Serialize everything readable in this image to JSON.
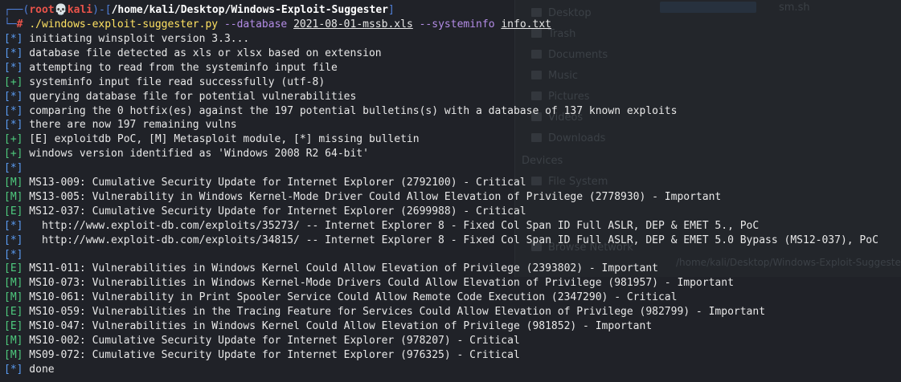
{
  "background_window": {
    "top_label": "sm.sh",
    "places": [
      {
        "label": "Desktop",
        "icon": "desktop-icon"
      },
      {
        "label": "Trash",
        "icon": "trash-icon"
      },
      {
        "label": "Documents",
        "icon": "folder-icon"
      },
      {
        "label": "Music",
        "icon": "folder-icon"
      },
      {
        "label": "Pictures",
        "icon": "folder-icon"
      },
      {
        "label": "Videos",
        "icon": "folder-icon"
      },
      {
        "label": "Downloads",
        "icon": "folder-icon"
      }
    ],
    "devices_heading": "Devices",
    "devices": [
      {
        "label": "File System",
        "icon": "drive-icon"
      }
    ],
    "network_label": "Browse Network",
    "path_text": "/home/kali/Desktop/Windows-Exploit-Suggester/"
  },
  "prompt": {
    "frame_start": "┌──(",
    "user": "root",
    "skull": "💀",
    "host": "kali",
    "frame_mid": ")-[",
    "cwd": "/home/kali/Desktop/Windows-Exploit-Suggester",
    "frame_end": "]",
    "frame_second": "└─",
    "hash": "#",
    "command": "./windows-exploit-suggester.py",
    "flag1": "--database",
    "arg1": "2021-08-01-mssb.xls",
    "flag2": "--systeminfo",
    "arg2": "info.txt"
  },
  "output_lines": [
    {
      "tag": "[*]",
      "kind": "info",
      "text": " initiating winsploit version 3.3..."
    },
    {
      "tag": "[*]",
      "kind": "info",
      "text": " database file detected as xls or xlsx based on extension"
    },
    {
      "tag": "[*]",
      "kind": "info",
      "text": " attempting to read from the systeminfo input file"
    },
    {
      "tag": "[+]",
      "kind": "ok",
      "text": " systeminfo input file read successfully (utf-8)"
    },
    {
      "tag": "[*]",
      "kind": "info",
      "text": " querying database file for potential vulnerabilities"
    },
    {
      "tag": "[*]",
      "kind": "info",
      "text": " comparing the 0 hotfix(es) against the 197 potential bulletins(s) with a database of 137 known exploits"
    },
    {
      "tag": "[*]",
      "kind": "info",
      "text": " there are now 197 remaining vulns"
    },
    {
      "tag": "[+]",
      "kind": "ok",
      "text": " [E] exploitdb PoC, [M] Metasploit module, [*] missing bulletin"
    },
    {
      "tag": "[+]",
      "kind": "ok",
      "text": " windows version identified as 'Windows 2008 R2 64-bit'"
    },
    {
      "tag": "[*]",
      "kind": "info",
      "text": ""
    },
    {
      "tag": "[M]",
      "kind": "m",
      "text": " MS13-009: Cumulative Security Update for Internet Explorer (2792100) - Critical"
    },
    {
      "tag": "[M]",
      "kind": "m",
      "text": " MS13-005: Vulnerability in Windows Kernel-Mode Driver Could Allow Elevation of Privilege (2778930) - Important"
    },
    {
      "tag": "[E]",
      "kind": "e",
      "text": " MS12-037: Cumulative Security Update for Internet Explorer (2699988) - Critical"
    },
    {
      "tag": "[*]",
      "kind": "info",
      "text": "   http://www.exploit-db.com/exploits/35273/ -- Internet Explorer 8 - Fixed Col Span ID Full ASLR, DEP & EMET 5., PoC"
    },
    {
      "tag": "[*]",
      "kind": "info",
      "text": "   http://www.exploit-db.com/exploits/34815/ -- Internet Explorer 8 - Fixed Col Span ID Full ASLR, DEP & EMET 5.0 Bypass (MS12-037), PoC"
    },
    {
      "tag": "[*]",
      "kind": "info",
      "text": ""
    },
    {
      "tag": "[E]",
      "kind": "e",
      "text": " MS11-011: Vulnerabilities in Windows Kernel Could Allow Elevation of Privilege (2393802) - Important"
    },
    {
      "tag": "[M]",
      "kind": "m",
      "text": " MS10-073: Vulnerabilities in Windows Kernel-Mode Drivers Could Allow Elevation of Privilege (981957) - Important"
    },
    {
      "tag": "[M]",
      "kind": "m",
      "text": " MS10-061: Vulnerability in Print Spooler Service Could Allow Remote Code Execution (2347290) - Critical"
    },
    {
      "tag": "[E]",
      "kind": "e",
      "text": " MS10-059: Vulnerabilities in the Tracing Feature for Services Could Allow Elevation of Privilege (982799) - Important"
    },
    {
      "tag": "[E]",
      "kind": "e",
      "text": " MS10-047: Vulnerabilities in Windows Kernel Could Allow Elevation of Privilege (981852) - Important"
    },
    {
      "tag": "[M]",
      "kind": "m",
      "text": " MS10-002: Cumulative Security Update for Internet Explorer (978207) - Critical"
    },
    {
      "tag": "[M]",
      "kind": "m",
      "text": " MS09-072: Cumulative Security Update for Internet Explorer (976325) - Critical"
    },
    {
      "tag": "[*]",
      "kind": "info",
      "text": " done"
    }
  ],
  "colors": {
    "terminal_bg": "#202228",
    "text": "#e8e8e8",
    "info_tag": "#5a9bf0",
    "ok_tag": "#4ec97d",
    "prompt_frame": "#4f7fd9",
    "prompt_user": "#e8534a",
    "command": "#ffe262",
    "flag": "#b38ce6"
  }
}
